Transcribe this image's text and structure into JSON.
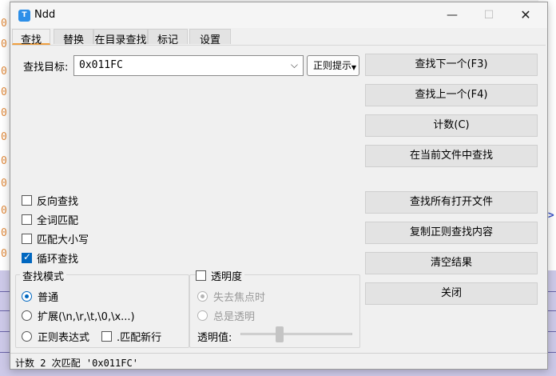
{
  "window": {
    "title": "Ndd",
    "icon_letter": "T"
  },
  "tabs": [
    {
      "label": "查找",
      "active": true
    },
    {
      "label": "替换",
      "active": false
    },
    {
      "label": "在目录查找",
      "active": false
    },
    {
      "label": "标记",
      "active": false
    },
    {
      "label": "设置",
      "active": false
    }
  ],
  "search": {
    "label": "查找目标:",
    "value": "0x011FC",
    "regex_hint_label": "正则提示"
  },
  "buttons": {
    "find_next": "查找下一个(F3)",
    "find_prev": "查找上一个(F4)",
    "count": "计数(C)",
    "find_in_current": "在当前文件中查找",
    "find_all_open": "查找所有打开文件",
    "copy_regex": "复制正则查找内容",
    "clear": "清空结果",
    "close": "关闭"
  },
  "options": {
    "reverse": {
      "label": "反向查找",
      "checked": false
    },
    "whole_word": {
      "label": "全词匹配",
      "checked": false
    },
    "match_case": {
      "label": "匹配大小写",
      "checked": false
    },
    "wrap": {
      "label": "循环查找",
      "checked": true
    }
  },
  "mode": {
    "title": "查找模式",
    "normal": "普通",
    "extended": "扩展(\\n,\\r,\\t,\\0,\\x...)",
    "regex": "正则表达式",
    "dot_newline": ".匹配新行",
    "selected": "normal"
  },
  "transparency": {
    "title": "透明度",
    "on_lose_focus": "失去焦点时",
    "always": "总是透明",
    "value_label": "透明值:",
    "value_fraction": 0.35
  },
  "status": {
    "text": "计数 2 次匹配 '0x011FC'"
  },
  "colors": {
    "accent": "#0067c0",
    "tab_underline": "#f0a040"
  }
}
